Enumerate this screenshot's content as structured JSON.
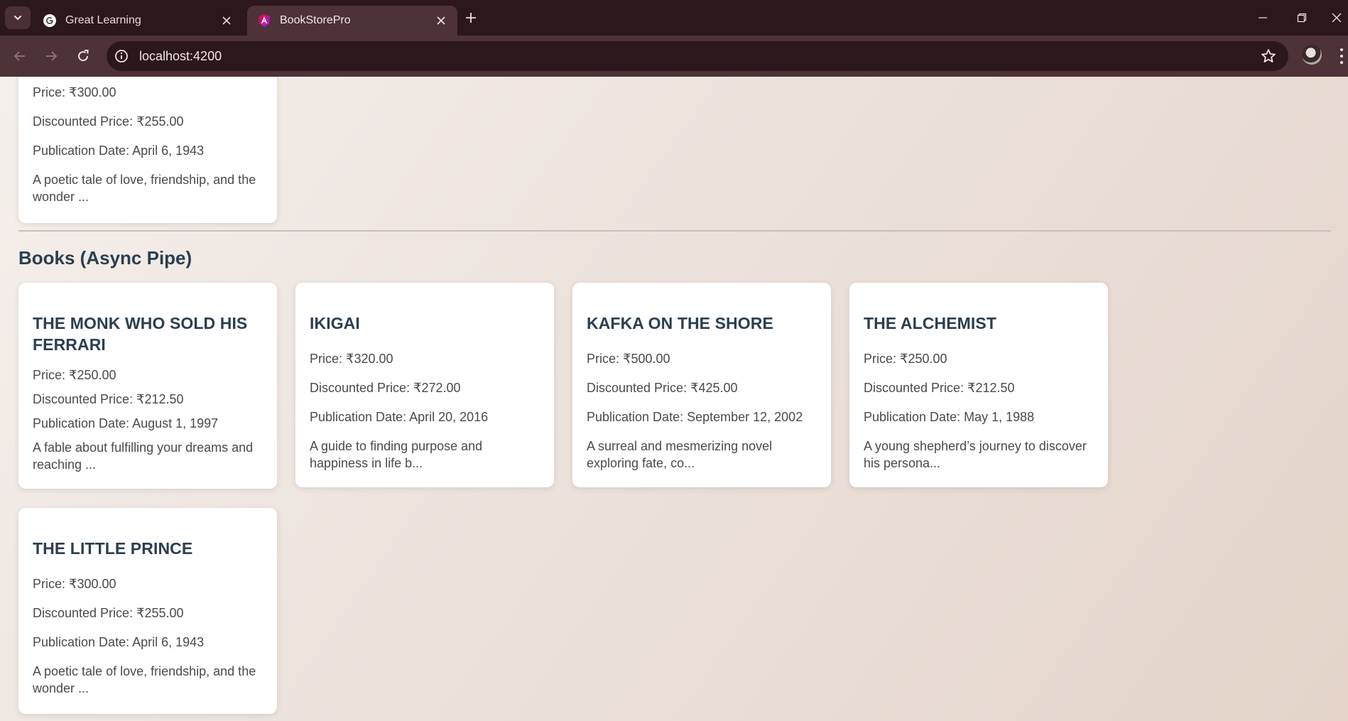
{
  "browser": {
    "tabs": [
      {
        "title": "Great Learning",
        "active": false,
        "favicon": "google-g-icon"
      },
      {
        "title": "BookStorePro",
        "active": true,
        "favicon": "angular-icon"
      }
    ],
    "url": "localhost:4200"
  },
  "prev_section": {
    "partial_card": {
      "price": "Price: ₹300.00",
      "discounted": "Discounted Price: ₹255.00",
      "pubdate": "Publication Date: April 6, 1943",
      "desc": "A poetic tale of love, friendship, and the wonder ..."
    }
  },
  "async_section": {
    "title": "Books (Async Pipe)",
    "books": [
      {
        "title": "THE MONK WHO SOLD HIS FERRARI",
        "price": "Price: ₹250.00",
        "discounted": "Discounted Price: ₹212.50",
        "pubdate": "Publication Date: August 1, 1997",
        "desc": "A fable about fulfilling your dreams and reaching ..."
      },
      {
        "title": "IKIGAI",
        "price": "Price: ₹320.00",
        "discounted": "Discounted Price: ₹272.00",
        "pubdate": "Publication Date: April 20, 2016",
        "desc": "A guide to finding purpose and happiness in life b..."
      },
      {
        "title": "KAFKA ON THE SHORE",
        "price": "Price: ₹500.00",
        "discounted": "Discounted Price: ₹425.00",
        "pubdate": "Publication Date: September 12, 2002",
        "desc": "A surreal and mesmerizing novel exploring fate, co..."
      },
      {
        "title": "THE ALCHEMIST",
        "price": "Price: ₹250.00",
        "discounted": "Discounted Price: ₹212.50",
        "pubdate": "Publication Date: May 1, 1988",
        "desc": "A young shepherd’s journey to discover his persona..."
      },
      {
        "title": "THE LITTLE PRINCE",
        "price": "Price: ₹300.00",
        "discounted": "Discounted Price: ₹255.00",
        "pubdate": "Publication Date: April 6, 1943",
        "desc": "A poetic tale of love, friendship, and the wonder ..."
      }
    ]
  },
  "colors": {
    "heading": "#2c3e50",
    "chrome_dark": "#2b171c",
    "chrome_active": "#4d3238"
  }
}
